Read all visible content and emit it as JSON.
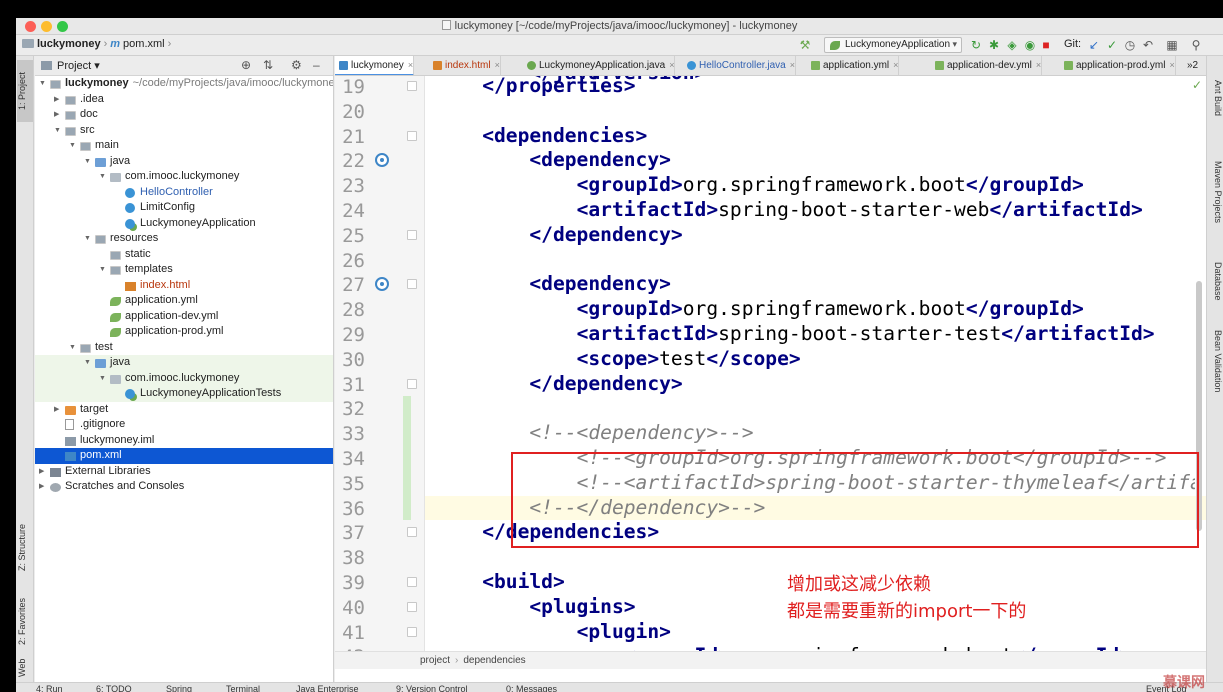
{
  "window": {
    "title": "luckymoney [~/code/myProjects/java/imooc/luckymoney] - luckymoney"
  },
  "navbar": {
    "crumb_project": "luckymoney",
    "crumb_file_icon": "m",
    "crumb_file": "pom.xml",
    "run_config": "LuckymoneyApplication",
    "git_label": "Git:"
  },
  "left_strip": {
    "project": "1: Project",
    "structure": "Z: Structure",
    "favorites": "2: Favorites",
    "web": "Web"
  },
  "right_strip": {
    "ant": "Ant Build",
    "maven": "Maven Projects",
    "database": "Database",
    "bean": "Bean Validation"
  },
  "project_panel": {
    "header": "Project",
    "tree": [
      {
        "label": "luckymoney",
        "path": "~/code/myProjects/java/imooc/luckymoney",
        "indent": 0,
        "open": true,
        "icon": "folder",
        "style": "bold"
      },
      {
        "label": ".idea",
        "indent": 1,
        "open": false,
        "icon": "folder"
      },
      {
        "label": "doc",
        "indent": 1,
        "open": false,
        "icon": "folder"
      },
      {
        "label": "src",
        "indent": 1,
        "open": true,
        "icon": "folder"
      },
      {
        "label": "main",
        "indent": 2,
        "open": true,
        "icon": "folder"
      },
      {
        "label": "java",
        "indent": 3,
        "open": true,
        "icon": "folder-blue"
      },
      {
        "label": "com.imooc.luckymoney",
        "indent": 4,
        "open": true,
        "icon": "package"
      },
      {
        "label": "HelloController",
        "indent": 5,
        "icon": "class",
        "style": "blue"
      },
      {
        "label": "LimitConfig",
        "indent": 5,
        "icon": "class"
      },
      {
        "label": "LuckymoneyApplication",
        "indent": 5,
        "icon": "spring-class"
      },
      {
        "label": "resources",
        "indent": 3,
        "open": true,
        "icon": "folder"
      },
      {
        "label": "static",
        "indent": 4,
        "icon": "folder"
      },
      {
        "label": "templates",
        "indent": 4,
        "open": true,
        "icon": "folder"
      },
      {
        "label": "index.html",
        "indent": 5,
        "icon": "html",
        "style": "red"
      },
      {
        "label": "application.yml",
        "indent": 4,
        "icon": "yml"
      },
      {
        "label": "application-dev.yml",
        "indent": 4,
        "icon": "yml"
      },
      {
        "label": "application-prod.yml",
        "indent": 4,
        "icon": "yml"
      },
      {
        "label": "test",
        "indent": 2,
        "open": true,
        "icon": "folder"
      },
      {
        "label": "java",
        "indent": 3,
        "open": true,
        "icon": "folder-blue",
        "highlight": true
      },
      {
        "label": "com.imooc.luckymoney",
        "indent": 4,
        "open": true,
        "icon": "package",
        "highlight": true
      },
      {
        "label": "LuckymoneyApplicationTests",
        "indent": 5,
        "icon": "spring-class",
        "highlight": true
      },
      {
        "label": "target",
        "indent": 1,
        "open": false,
        "icon": "folder-orange"
      },
      {
        "label": ".gitignore",
        "indent": 1,
        "icon": "file"
      },
      {
        "label": "luckymoney.iml",
        "indent": 1,
        "icon": "iml"
      },
      {
        "label": "pom.xml",
        "indent": 1,
        "icon": "xml",
        "selected": true
      },
      {
        "label": "External Libraries",
        "indent": 0,
        "open": false,
        "icon": "lib"
      },
      {
        "label": "Scratches and Consoles",
        "indent": 0,
        "open": false,
        "icon": "scratch"
      }
    ]
  },
  "editor": {
    "tabs": [
      {
        "label": "luckymoney",
        "active": true,
        "icon": "xml"
      },
      {
        "label": "index.html",
        "style": "red",
        "icon": "html"
      },
      {
        "label": "LuckymoneyApplication.java",
        "icon": "spring"
      },
      {
        "label": "HelloController.java",
        "style": "blue",
        "icon": "class"
      },
      {
        "label": "application.yml",
        "icon": "yml"
      },
      {
        "label": "application-dev.yml",
        "icon": "yml"
      },
      {
        "label": "application-prod.yml",
        "icon": "yml"
      }
    ],
    "tab_overflow": "2",
    "lines": [
      {
        "n": "19",
        "code": [
          [
            "    ",
            ""
          ],
          [
            "</properties>",
            "tag"
          ]
        ]
      },
      {
        "n": "20",
        "code": []
      },
      {
        "n": "21",
        "code": [
          [
            "    ",
            ""
          ],
          [
            "<dependencies>",
            "tag"
          ]
        ]
      },
      {
        "n": "22",
        "code": [
          [
            "        ",
            ""
          ],
          [
            "<dependency>",
            "tag"
          ]
        ],
        "gicon": true
      },
      {
        "n": "23",
        "code": [
          [
            "            ",
            ""
          ],
          [
            "<groupId>",
            "tag"
          ],
          [
            "org.springframework.boot",
            ""
          ],
          [
            "</groupId>",
            "tag"
          ]
        ]
      },
      {
        "n": "24",
        "code": [
          [
            "            ",
            ""
          ],
          [
            "<artifactId>",
            "tag"
          ],
          [
            "spring-boot-starter-web",
            ""
          ],
          [
            "</artifactId>",
            "tag"
          ]
        ]
      },
      {
        "n": "25",
        "code": [
          [
            "        ",
            ""
          ],
          [
            "</dependency>",
            "tag"
          ]
        ]
      },
      {
        "n": "26",
        "code": []
      },
      {
        "n": "27",
        "code": [
          [
            "        ",
            ""
          ],
          [
            "<dependency>",
            "tag"
          ]
        ],
        "gicon": true
      },
      {
        "n": "28",
        "code": [
          [
            "            ",
            ""
          ],
          [
            "<groupId>",
            "tag"
          ],
          [
            "org.springframework.boot",
            ""
          ],
          [
            "</groupId>",
            "tag"
          ]
        ]
      },
      {
        "n": "29",
        "code": [
          [
            "            ",
            ""
          ],
          [
            "<artifactId>",
            "tag"
          ],
          [
            "spring-boot-starter-test",
            ""
          ],
          [
            "</artifactId>",
            "tag"
          ]
        ]
      },
      {
        "n": "30",
        "code": [
          [
            "            ",
            ""
          ],
          [
            "<scope>",
            "tag"
          ],
          [
            "test",
            ""
          ],
          [
            "</scope>",
            "tag"
          ]
        ]
      },
      {
        "n": "31",
        "code": [
          [
            "        ",
            ""
          ],
          [
            "</dependency>",
            "tag"
          ]
        ]
      },
      {
        "n": "32",
        "code": [],
        "changed": true
      },
      {
        "n": "33",
        "code": [
          [
            "        ",
            ""
          ],
          [
            "<!--<dependency>-->",
            "comment"
          ]
        ],
        "changed": true
      },
      {
        "n": "34",
        "code": [
          [
            "            ",
            ""
          ],
          [
            "<!--<groupId>org.springframework.boot</groupId>-->",
            "comment"
          ]
        ],
        "changed": true
      },
      {
        "n": "35",
        "code": [
          [
            "            ",
            ""
          ],
          [
            "<!--<artifactId>spring-boot-starter-thymeleaf</artifactId>-->",
            "comment"
          ]
        ],
        "changed": true
      },
      {
        "n": "36",
        "code": [
          [
            "        ",
            ""
          ],
          [
            "<!--</dependency>-->",
            "comment"
          ]
        ],
        "changed": true,
        "current": true
      },
      {
        "n": "37",
        "code": [
          [
            "    ",
            ""
          ],
          [
            "</dependencies>",
            "tag"
          ]
        ]
      },
      {
        "n": "38",
        "code": []
      },
      {
        "n": "39",
        "code": [
          [
            "    ",
            ""
          ],
          [
            "<build>",
            "tag"
          ]
        ]
      },
      {
        "n": "40",
        "code": [
          [
            "        ",
            ""
          ],
          [
            "<plugins>",
            "tag"
          ]
        ]
      },
      {
        "n": "41",
        "code": [
          [
            "            ",
            ""
          ],
          [
            "<plugin>",
            "tag"
          ]
        ]
      },
      {
        "n": "42",
        "code": [
          [
            "                ",
            ""
          ],
          [
            "<groupId>",
            "tag"
          ],
          [
            "org.springframework.boot",
            ""
          ],
          [
            "</groupId>",
            "tag"
          ]
        ]
      }
    ],
    "partial_top": [
      [
        "        ",
        ""
      ],
      [
        "</java.version>",
        "tag"
      ]
    ],
    "breadcrumb": [
      "project",
      "dependencies"
    ],
    "annotation": [
      "增加或这减少依赖",
      "都是需要重新的import一下的"
    ]
  },
  "bottom_bar": {
    "items": [
      "4: Run",
      "6: TODO",
      "Spring",
      "Terminal",
      "Java Enterprise",
      "9: Version Control",
      "0: Messages",
      "Event Log"
    ]
  },
  "watermark": "慕课网"
}
